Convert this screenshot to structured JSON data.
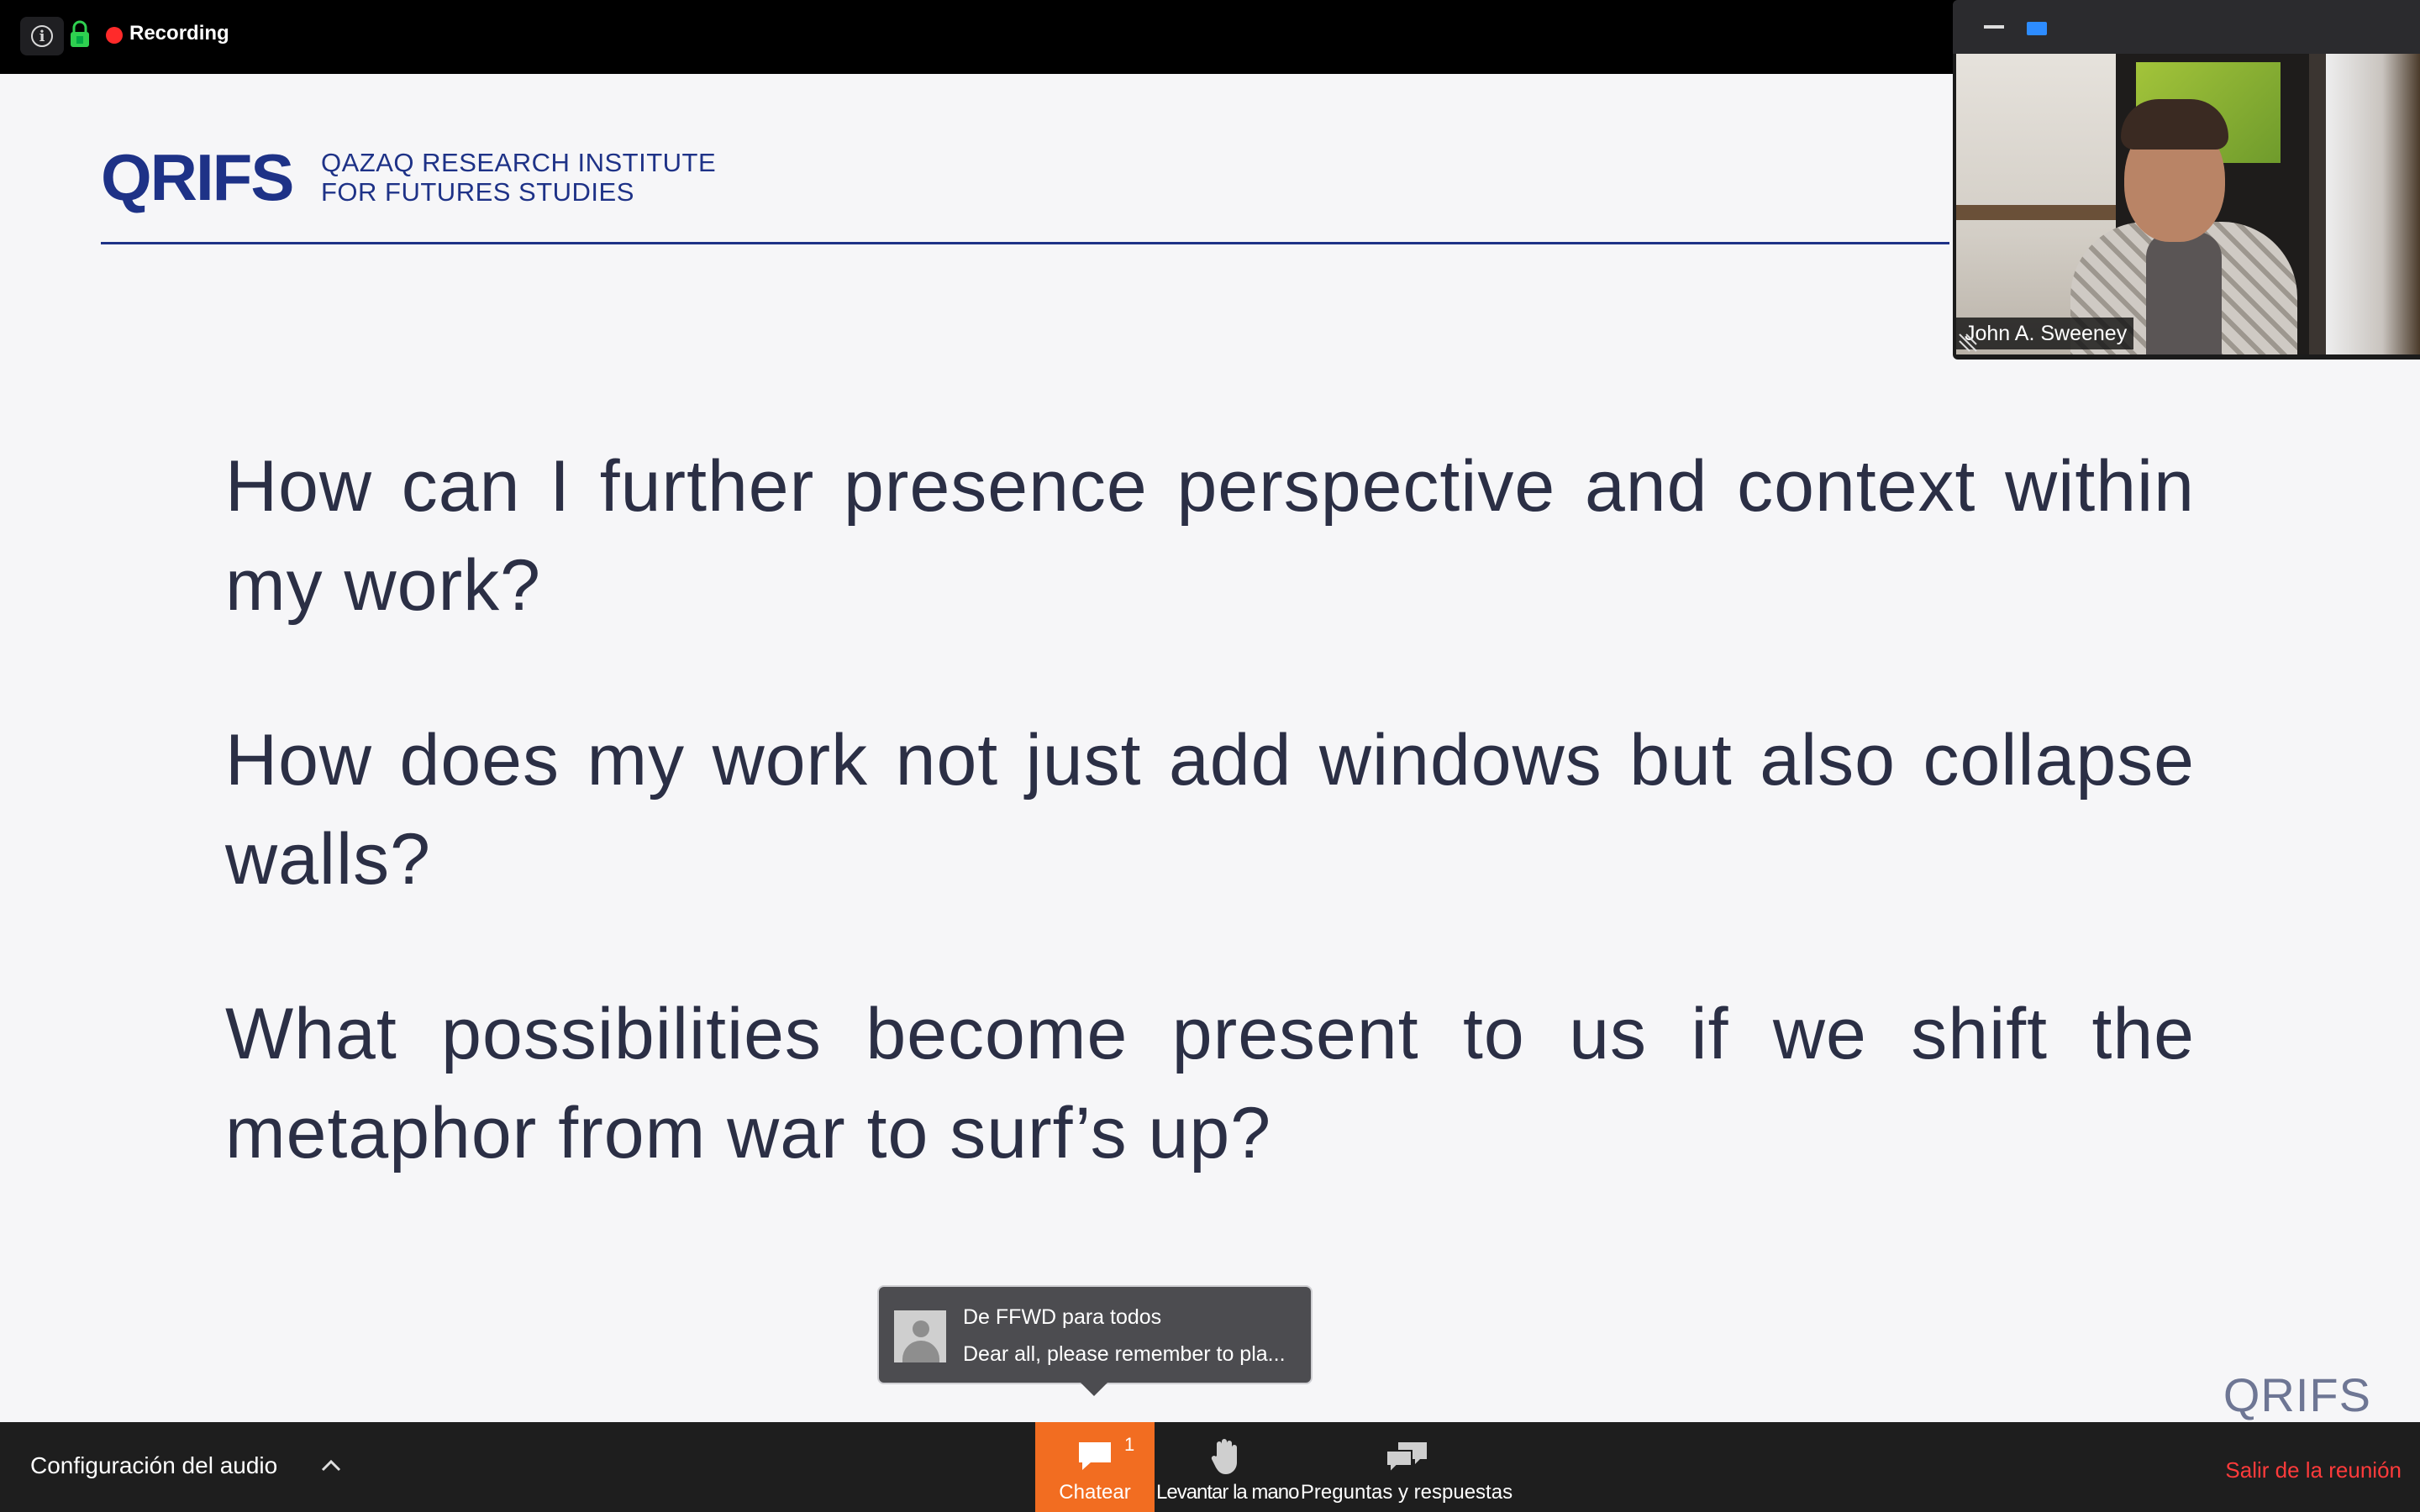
{
  "topbar": {
    "recording_label": "Recording"
  },
  "slide": {
    "logo_mark": "QRIFS",
    "logo_line1": "QAZAQ RESEARCH INSTITUTE",
    "logo_line2": "FOR FUTURES STUDIES",
    "questions": [
      "How can I further presence perspective and context within my work?",
      "How does my work not just add windows but also collapse walls?",
      "What possibilities become present to us if we shift the metaphor from war to surf’s up?"
    ],
    "corner_brand": "QRIFS",
    "brand_color": "#1e3287"
  },
  "video": {
    "participant_name": "John A. Sweeney"
  },
  "chat_notification": {
    "sender": "De FFWD para todos",
    "message": "Dear all, please remember to pla..."
  },
  "toolbar": {
    "audio_settings_label": "Configuración del audio",
    "chat_label": "Chatear",
    "chat_badge": "1",
    "raise_hand_label": "Levantar la mano",
    "qa_label": "Preguntas y respuestas",
    "leave_label": "Salir de la reunión",
    "accent_color": "#f26d21",
    "leave_color": "#ff3b3b"
  },
  "icons": [
    "info-icon",
    "lock-icon",
    "recording-dot-icon",
    "minimize-icon",
    "view-icon",
    "resize-icon",
    "avatar-icon",
    "chevron-up-icon",
    "chat-icon",
    "raise-hand-icon",
    "qa-icon"
  ]
}
